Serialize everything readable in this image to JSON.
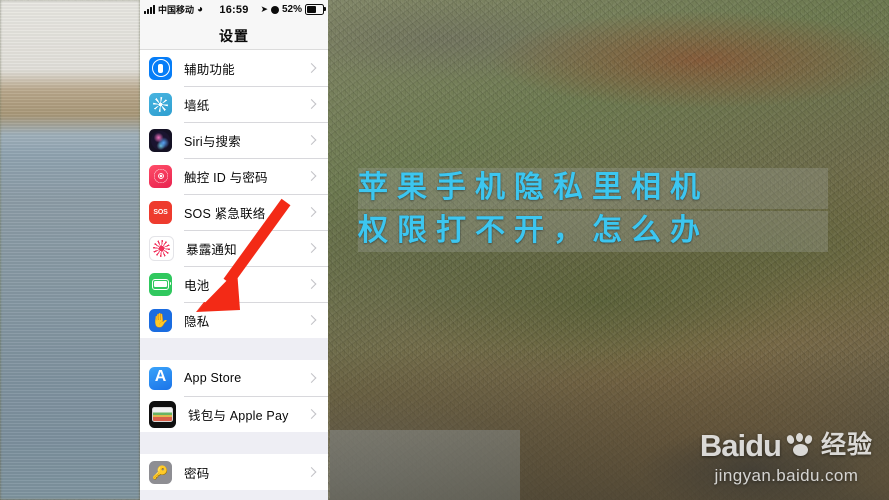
{
  "status_bar": {
    "carrier": "中国移动",
    "time": "16:59",
    "battery_percent": "52%",
    "signal_icon": "signal-bars-icon",
    "wifi_icon": "wifi-icon",
    "location_icon": "location-arrow-icon",
    "alarm_icon": "alarm-clock-icon",
    "battery_icon": "battery-icon"
  },
  "nav": {
    "title": "设置"
  },
  "sections": [
    {
      "name": "general-section",
      "rows": [
        {
          "label": "辅助功能",
          "icon": "accessibility-icon",
          "icon_color": "#067df7"
        },
        {
          "label": "墙纸",
          "icon": "wallpaper-icon",
          "icon_color": "#3aa8d6"
        },
        {
          "label": "Siri与搜索",
          "icon": "siri-icon",
          "icon_color": "#141124"
        },
        {
          "label": "触控 ID 与密码",
          "icon": "touch-id-icon",
          "icon_color": "#e8234f"
        },
        {
          "label": "SOS 紧急联络",
          "icon": "sos-icon",
          "icon_color": "#ee3b2e"
        },
        {
          "label": "暴露通知",
          "icon": "exposure-notification-icon",
          "icon_color": "#f0325c"
        },
        {
          "label": "电池",
          "icon": "battery-settings-icon",
          "icon_color": "#30c85e"
        },
        {
          "label": "隐私",
          "icon": "privacy-hand-icon",
          "icon_color": "#1a6ce0"
        }
      ]
    },
    {
      "name": "store-section",
      "rows": [
        {
          "label": "App Store",
          "icon": "app-store-icon",
          "icon_color": "#1a73e8"
        },
        {
          "label": "钱包与 Apple Pay",
          "icon": "wallet-icon",
          "icon_color": "#0f0f0f"
        }
      ]
    },
    {
      "name": "passwords-section",
      "rows": [
        {
          "label": "密码",
          "icon": "password-key-icon",
          "icon_color": "#8e8e93"
        }
      ]
    }
  ],
  "annotation": {
    "arrow_icon": "red-arrow-pointing-down-left",
    "arrow_color": "#f32a16",
    "points_at": "隐私"
  },
  "caption": {
    "line1": "苹果手机隐私里相机",
    "line2": "权限打不开，怎么办",
    "text_color": "#3cc6f0"
  },
  "watermark": {
    "brand": "Baidu",
    "brand_cn": "经验",
    "url": "jingyan.baidu.com",
    "paw_icon": "baidu-paw-icon"
  }
}
